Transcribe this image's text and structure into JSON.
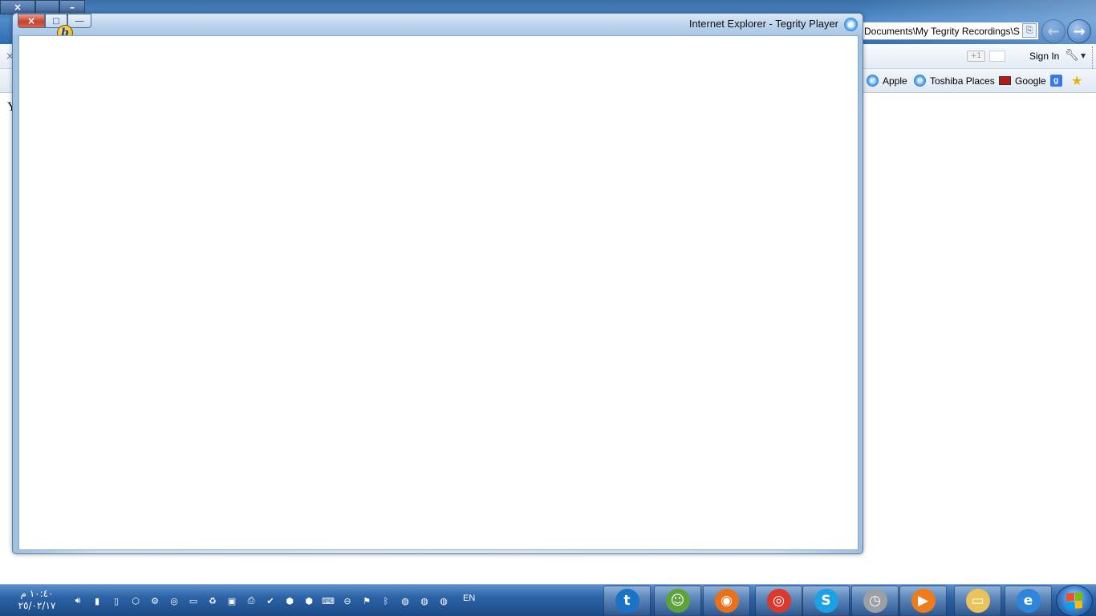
{
  "browser": {
    "address": "Documents\\My Tegrity Recordings\\S",
    "tab_close_glyph": "×",
    "page_letter": "Y",
    "command_bar": {
      "plus_one": "+1",
      "sign_in": "Sign In"
    },
    "favorites": [
      {
        "label": "Apple",
        "icon": "ie-icon"
      },
      {
        "label": "Toshiba Places",
        "icon": "ie-icon"
      },
      {
        "label": "Google",
        "icon": "toshiba-icon"
      }
    ]
  },
  "popup": {
    "title": "Internet Explorer - Tegrity Player",
    "close_glyph": "×",
    "max_glyph": "□",
    "min_glyph": "—",
    "badge": "b"
  },
  "taskbar": {
    "time": "١٠:٤٠ م",
    "date": "٢٥/٠٢/١٧",
    "language": "EN",
    "tray_icons": [
      "speaker-icon",
      "signal-icon",
      "battery-icon",
      "shield-icon",
      "network-icon",
      "sync-icon",
      "monitor-icon",
      "recycle-icon",
      "display-icon",
      "printer-icon",
      "check-icon",
      "antivirus-icon",
      "antivirus-icon",
      "keyboard-icon",
      "minus-icon",
      "flag-icon",
      "bluetooth-icon",
      "blue-icon",
      "blue-icon",
      "blue-icon"
    ],
    "apps": [
      {
        "name": "tegrity-icon",
        "glyph": "t",
        "color": "#1a73c7"
      },
      {
        "name": "messenger-icon",
        "glyph": "☺",
        "color": "#5fa23b"
      },
      {
        "name": "firefox-icon",
        "glyph": "◉",
        "color": "#e8711a"
      },
      {
        "name": "chrome-icon",
        "glyph": "◎",
        "color": "#d93a2b"
      },
      {
        "name": "skype-icon",
        "glyph": "S",
        "color": "#1da1e6"
      },
      {
        "name": "clock-app-icon",
        "glyph": "◷",
        "color": "#9aa0a6"
      },
      {
        "name": "media-player-icon",
        "glyph": "▶",
        "color": "#ef7c1a"
      },
      {
        "name": "explorer-icon",
        "glyph": "▭",
        "color": "#e8c45a"
      },
      {
        "name": "internet-explorer-icon",
        "glyph": "e",
        "color": "#2f86d8"
      }
    ]
  }
}
